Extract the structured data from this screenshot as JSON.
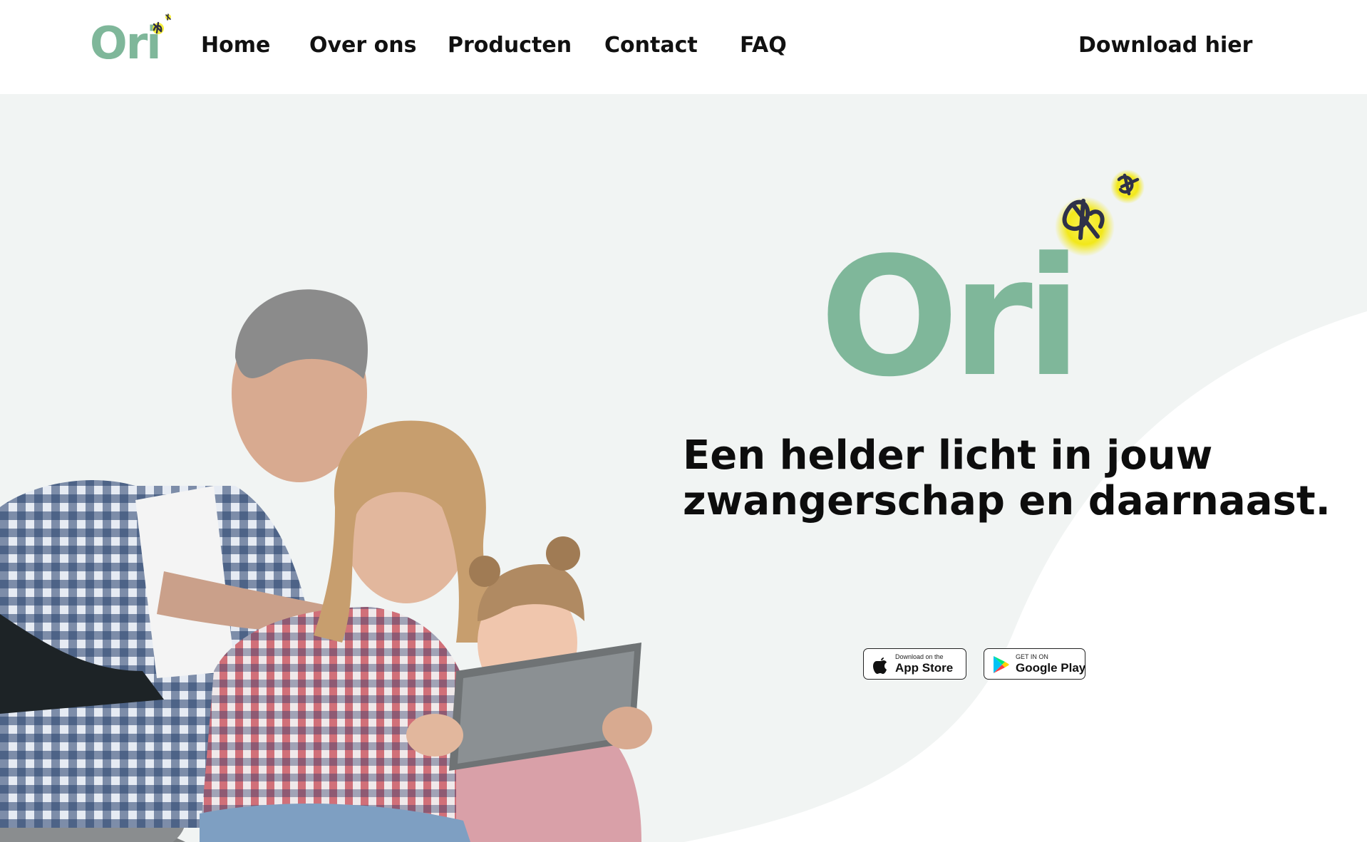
{
  "brand": {
    "name": "Ori",
    "color": "#7fb79a",
    "firefly_color": "#f4ec1a"
  },
  "nav": {
    "items": [
      {
        "label": "Home"
      },
      {
        "label": "Over ons"
      },
      {
        "label": "Producten"
      },
      {
        "label": "Contact"
      },
      {
        "label": "FAQ"
      }
    ],
    "download_label": "Download hier"
  },
  "hero": {
    "tagline_line1": "Een helder licht in jouw",
    "tagline_line2": "zwangerschap en daarnaast.",
    "app_store": {
      "small": "Download on the",
      "big": "App Store",
      "icon": "apple-icon"
    },
    "google_play": {
      "small": "GET IN ON",
      "big": "Google Play",
      "icon": "google-play-icon"
    }
  },
  "colors": {
    "hero_bg": "#f1f4f3",
    "curve": "#ffffff",
    "text": "#111111"
  }
}
